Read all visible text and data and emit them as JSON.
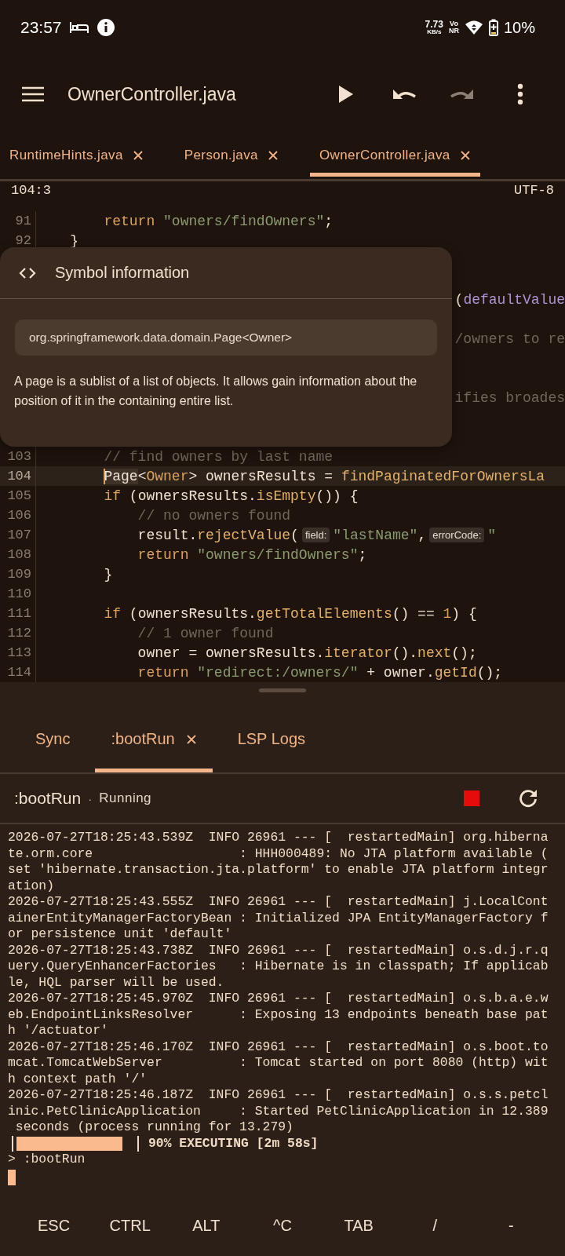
{
  "status_bar": {
    "time": "23:57",
    "net_speed": "7.73",
    "net_unit": "KB/s",
    "volte": "Vo",
    "network": "NR",
    "battery": "10%"
  },
  "toolbar": {
    "title": "OwnerController.java",
    "actions": [
      {
        "kind": "run",
        "disabled": false
      },
      {
        "kind": "undo",
        "disabled": false
      },
      {
        "kind": "redo",
        "disabled": true
      },
      {
        "kind": "more",
        "disabled": false
      }
    ]
  },
  "file_tabs": [
    {
      "label": "RuntimeHints.java",
      "selected": false
    },
    {
      "label": "Person.java",
      "selected": false
    },
    {
      "label": "OwnerController.java",
      "selected": true
    }
  ],
  "editor": {
    "cursor_position": "104:3",
    "encoding": "UTF-8",
    "lines": [
      {
        "number": "91",
        "covered": false,
        "current": false,
        "tokens": [
          {
            "kind": "keyword",
            "text": "        return "
          },
          {
            "kind": "string",
            "text": "\"owners/findOwners\""
          },
          {
            "kind": "plain",
            "text": ";"
          }
        ]
      },
      {
        "number": "92",
        "covered": false,
        "current": false,
        "tokens": [
          {
            "kind": "plain",
            "text": "    }"
          }
        ]
      },
      {
        "covered": true,
        "tokens": [
          {
            "kind": "plain",
            "text": "("
          },
          {
            "kind": "param",
            "text": "defaultValue"
          }
        ]
      },
      {
        "covered": true,
        "tokens": [
          {
            "kind": "comment",
            "text": "/owners to re"
          }
        ]
      },
      {
        "covered": true,
        "tokens": [
          {
            "kind": "comment",
            "text": "ifies broades"
          }
        ]
      },
      {
        "number": "103",
        "covered": false,
        "current": false,
        "tokens": [
          {
            "kind": "comment",
            "text": "        // find owners by last name"
          }
        ]
      },
      {
        "number": "104",
        "covered": false,
        "current": true,
        "tokens": [
          {
            "kind": "symbol",
            "text": "        Page"
          },
          {
            "kind": "plain",
            "text": "<"
          },
          {
            "kind": "type",
            "text": "Owner"
          },
          {
            "kind": "plain",
            "text": "> ownersResults = "
          },
          {
            "kind": "method",
            "text": "findPaginatedForOwnersLa"
          }
        ]
      },
      {
        "number": "105",
        "covered": false,
        "current": false,
        "tokens": [
          {
            "kind": "keyword",
            "text": "        if "
          },
          {
            "kind": "plain",
            "text": "(ownersResults."
          },
          {
            "kind": "method",
            "text": "isEmpty"
          },
          {
            "kind": "plain",
            "text": "()) {"
          }
        ]
      },
      {
        "number": "106",
        "covered": false,
        "current": false,
        "tokens": [
          {
            "kind": "comment",
            "text": "            // no owners found"
          }
        ]
      },
      {
        "number": "107",
        "covered": false,
        "current": false,
        "tokens": [
          {
            "kind": "plain",
            "text": "            result."
          },
          {
            "kind": "method",
            "text": "rejectValue"
          },
          {
            "kind": "plain",
            "text": "("
          },
          {
            "kind": "hint",
            "text": "field:"
          },
          {
            "kind": "string",
            "text": "\"lastName\""
          },
          {
            "kind": "plain",
            "text": ","
          },
          {
            "kind": "hint",
            "text": "errorCode:"
          },
          {
            "kind": "string",
            "text": "\""
          }
        ]
      },
      {
        "number": "108",
        "covered": false,
        "current": false,
        "tokens": [
          {
            "kind": "keyword",
            "text": "            return "
          },
          {
            "kind": "string",
            "text": "\"owners/findOwners\""
          },
          {
            "kind": "plain",
            "text": ";"
          }
        ]
      },
      {
        "number": "109",
        "covered": false,
        "current": false,
        "tokens": [
          {
            "kind": "plain",
            "text": "        }"
          }
        ]
      },
      {
        "number": "110",
        "covered": false,
        "current": false
      },
      {
        "number": "111",
        "covered": false,
        "current": false,
        "tokens": [
          {
            "kind": "keyword",
            "text": "        if "
          },
          {
            "kind": "plain",
            "text": "(ownersResults."
          },
          {
            "kind": "method",
            "text": "getTotalElements"
          },
          {
            "kind": "plain",
            "text": "() == "
          },
          {
            "kind": "number",
            "text": "1"
          },
          {
            "kind": "plain",
            "text": ") {"
          }
        ]
      },
      {
        "number": "112",
        "covered": false,
        "current": false,
        "tokens": [
          {
            "kind": "comment",
            "text": "            // 1 owner found"
          }
        ]
      },
      {
        "number": "113",
        "covered": false,
        "current": false,
        "tokens": [
          {
            "kind": "plain",
            "text": "            owner = ownersResults."
          },
          {
            "kind": "method",
            "text": "iterator"
          },
          {
            "kind": "plain",
            "text": "()."
          },
          {
            "kind": "method",
            "text": "next"
          },
          {
            "kind": "plain",
            "text": "();"
          }
        ]
      },
      {
        "number": "114",
        "covered": false,
        "current": false,
        "tokens": [
          {
            "kind": "keyword",
            "text": "            return "
          },
          {
            "kind": "string",
            "text": "\"redirect:/owners/\""
          },
          {
            "kind": "plain",
            "text": " + owner."
          },
          {
            "kind": "method",
            "text": "getId"
          },
          {
            "kind": "plain",
            "text": "();"
          }
        ]
      }
    ]
  },
  "symbol_popup": {
    "title": "Symbol information",
    "signature": "org.springframework.data.domain.Page<Owner>",
    "description": "A page is a sublist of a list of objects. It allows gain information about the position of it in the containing entire list."
  },
  "bottom_panel": {
    "tabs": [
      {
        "label": "Sync",
        "closable": false,
        "selected": false
      },
      {
        "label": ":bootRun",
        "closable": true,
        "selected": true
      },
      {
        "label": "LSP Logs",
        "closable": false,
        "selected": false
      }
    ],
    "task": {
      "name": ":bootRun",
      "separator": "·",
      "status": "Running",
      "running": true
    },
    "log_entries": [
      "2026-07-27T18:25:43.539Z  INFO 26961 --- [  restartedMain] org.hibernate.orm.core                   : HHH000489: No JTA platform available (set 'hibernate.transaction.jta.platform' to enable JTA platform integration)",
      "2026-07-27T18:25:43.555Z  INFO 26961 --- [  restartedMain] j.LocalContainerEntityManagerFactoryBean : Initialized JPA EntityManagerFactory for persistence unit 'default'",
      "2026-07-27T18:25:43.738Z  INFO 26961 --- [  restartedMain] o.s.d.j.r.query.QueryEnhancerFactories   : Hibernate is in classpath; If applicable, HQL parser will be used.",
      "2026-07-27T18:25:45.970Z  INFO 26961 --- [  restartedMain] o.s.b.a.e.web.EndpointLinksResolver      : Exposing 13 endpoints beneath base path '/actuator'",
      "2026-07-27T18:25:46.170Z  INFO 26961 --- [  restartedMain] o.s.boot.tomcat.TomcatWebServer          : Tomcat started on port 8080 (http) with context path '/'",
      "2026-07-27T18:25:46.187Z  INFO 26961 --- [  restartedMain] o.s.s.petclinic.PetClinicApplication     : Started PetClinicApplication in 12.389 seconds (process running for 13.279)"
    ],
    "progress": {
      "level": 0.9,
      "text": "90% EXECUTING [2m 58s]"
    },
    "prompt": "> :bootRun"
  },
  "extra_keys": [
    "ESC",
    "CTRL",
    "ALT",
    "^C",
    "TAB",
    "/",
    "-"
  ]
}
